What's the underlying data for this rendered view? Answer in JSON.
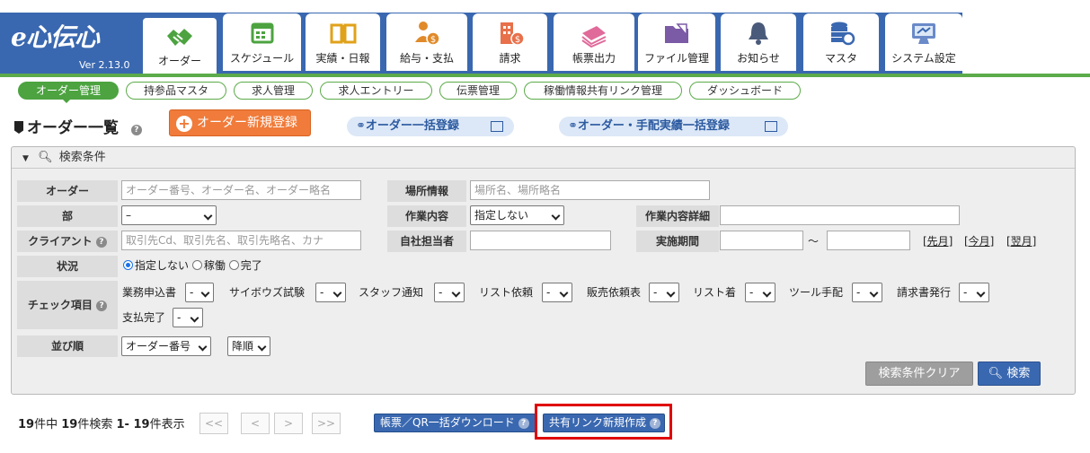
{
  "app": {
    "brand": "e心伝心",
    "version": "Ver 2.13.0"
  },
  "main_tabs": [
    {
      "label": "オーダー",
      "icon": "handshake-icon",
      "active": true
    },
    {
      "label": "スケジュール",
      "icon": "calendar-icon"
    },
    {
      "label": "実績・日報",
      "icon": "book-icon"
    },
    {
      "label": "給与・支払",
      "icon": "payroll-person-icon"
    },
    {
      "label": "請求",
      "icon": "building-invoice-icon"
    },
    {
      "label": "帳票出力",
      "icon": "documents-stack-icon"
    },
    {
      "label": "ファイル管理",
      "icon": "folder-icon"
    },
    {
      "label": "お知らせ",
      "icon": "bell-icon"
    },
    {
      "label": "マスタ",
      "icon": "database-icon"
    },
    {
      "label": "システム設定",
      "icon": "monitor-settings-icon"
    }
  ],
  "sub_tabs": [
    "オーダー管理",
    "持参品マスタ",
    "求人管理",
    "求人エントリー",
    "伝票管理",
    "稼働情報共有リンク管理",
    "ダッシュボード"
  ],
  "page": {
    "title": "オーダー一覧",
    "new_order": "オーダー新規登録",
    "bulk_order": "オーダー一括登録",
    "bulk_order_arrange": "オーダー・手配実績一括登録"
  },
  "search": {
    "header": "検索条件",
    "labels": {
      "order": "オーダー",
      "place": "場所情報",
      "dept": "部",
      "work": "作業内容",
      "work_detail": "作業内容詳細",
      "client": "クライアント",
      "staff": "自社担当者",
      "period": "実施期間",
      "status": "状況",
      "check": "チェック項目",
      "sort": "並び順"
    },
    "placeholders": {
      "order": "オーダー番号、オーダー名、オーダー略名",
      "place": "場所名、場所略名",
      "client": "取引先Cd、取引先名、取引先略名、カナ"
    },
    "dept_value": "–",
    "work_value": "指定しない",
    "period_sep": "～",
    "period_links": [
      "[先月]",
      "[今月]",
      "[翌月]"
    ],
    "status_options": [
      {
        "label": "指定しない",
        "checked": true
      },
      {
        "label": "稼働",
        "checked": false
      },
      {
        "label": "完了",
        "checked": false
      }
    ],
    "checks": [
      {
        "label": "業務申込書",
        "value": "-"
      },
      {
        "label": "サイボウズ試験",
        "value": "-"
      },
      {
        "label": "スタッフ通知",
        "value": "-"
      },
      {
        "label": "リスト依頼",
        "value": "-"
      },
      {
        "label": "販売依頼表",
        "value": "-"
      },
      {
        "label": "リスト着",
        "value": "-"
      },
      {
        "label": "ツール手配",
        "value": "-"
      },
      {
        "label": "請求書発行",
        "value": "-"
      },
      {
        "label": "支払完了",
        "value": "-"
      }
    ],
    "sort_field": "オーダー番号",
    "sort_order": "降順",
    "clear_label": "検索条件クリア",
    "search_label": "検索"
  },
  "results": {
    "total": "19",
    "total_suffix": "件中",
    "found": "19",
    "found_suffix": "件検索",
    "range": "1- 19",
    "range_suffix": "件表示",
    "pager": [
      "<<",
      "<",
      ">",
      ">>"
    ],
    "download_label": "帳票／QR一括ダウンロード",
    "share_label": "共有リンク新規作成"
  },
  "colors": {
    "header_blue": "#3a68b0",
    "nav_green": "#4ca340",
    "new_button_orange": "#f07b3a",
    "highlight_red": "#e00000"
  }
}
